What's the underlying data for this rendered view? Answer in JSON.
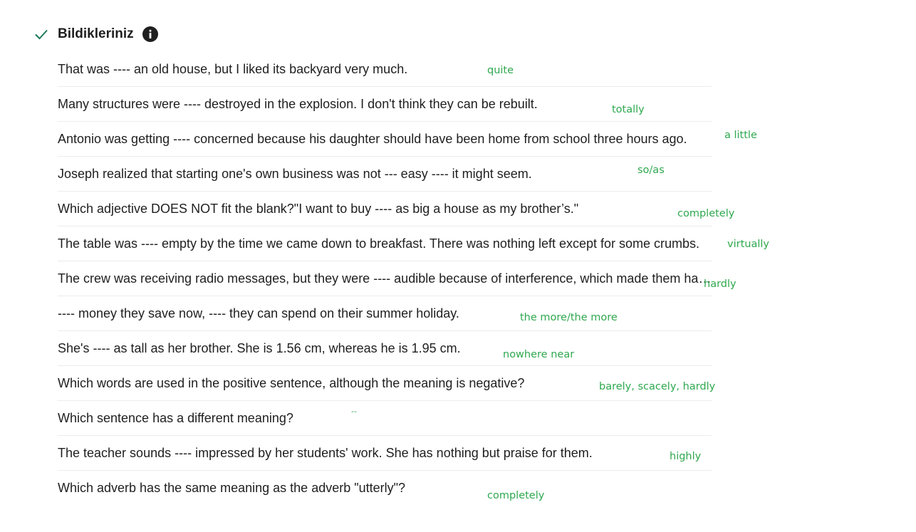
{
  "section": {
    "title": "Bildikleriniz",
    "check_icon": "check-icon",
    "info_icon": "info-icon",
    "accent_color": "#2fa84f"
  },
  "questions": [
    {
      "text": "That was ---- an old house, but I liked its backyard very much."
    },
    {
      "text": "Many structures were ---- destroyed in the explosion. I don't think they can be rebuilt."
    },
    {
      "text": "Antonio was getting ---- concerned because his daughter should have been home from school three hours ago."
    },
    {
      "text": "Joseph realized that starting one's own business was not --- easy ---- it might seem."
    },
    {
      "text": "Which adjective DOES NOT fit the blank?\"I want to buy ---- as big a house as my brother’s.\""
    },
    {
      "text": "The table was ---- empty by the time we came down to breakfast. There was nothing left except for some crumbs."
    },
    {
      "text": "The crew was receiving radio messages, but they were ---- audible because of interference, which made them hard to understand."
    },
    {
      "text": "---- money they save now, ---- they can spend on their summer holiday."
    },
    {
      "text": "She's ---- as tall as her brother. She is 1.56 cm, whereas he is 1.95 cm."
    },
    {
      "text": "Which words are used in the positive sentence, although the meaning is negative?"
    },
    {
      "text": "Which sentence has a different meaning?"
    },
    {
      "text": "The teacher sounds ---- impressed by her students' work. She has nothing but praise for them."
    },
    {
      "text": "Which adverb has the same meaning as the adverb \"utterly\"?"
    }
  ],
  "annotations": [
    {
      "text": "quite"
    },
    {
      "text": "totally"
    },
    {
      "text": "a little"
    },
    {
      "text": "so/as"
    },
    {
      "text": "completely"
    },
    {
      "text": "virtually"
    },
    {
      "text": "hardly"
    },
    {
      "text": "the more/the more"
    },
    {
      "text": "nowhere near"
    },
    {
      "text": "barely, scacely, hardly"
    },
    {
      "text": "--"
    },
    {
      "text": "highly"
    },
    {
      "text": "completely"
    }
  ]
}
